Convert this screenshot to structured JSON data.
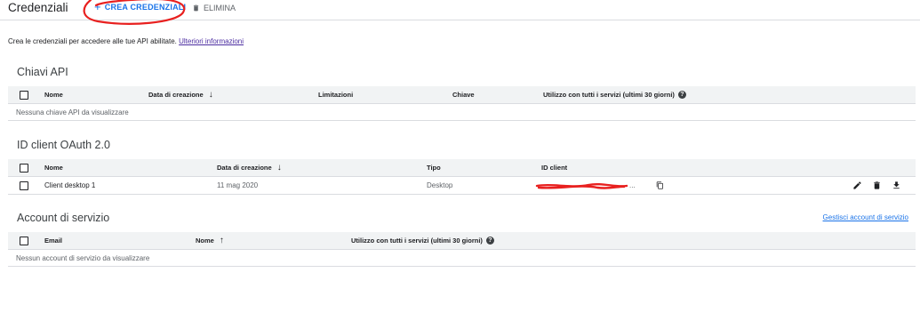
{
  "header": {
    "title": "Credenziali",
    "create_label": "CREA CREDENZIALI",
    "delete_label": "ELIMINA"
  },
  "intro": {
    "text": "Crea le credenziali per accedere alle tue API abilitate.",
    "link": "Ulteriori informazioni"
  },
  "api_keys": {
    "title": "Chiavi API",
    "columns": [
      "Nome",
      "Data di creazione",
      "Limitazioni",
      "Chiave",
      "Utilizzo con tutti i servizi (ultimi 30 giorni)"
    ],
    "empty": "Nessuna chiave API da visualizzare"
  },
  "oauth": {
    "title": "ID client OAuth 2.0",
    "columns": [
      "Nome",
      "Data di creazione",
      "Tipo",
      "ID client"
    ],
    "rows": [
      {
        "name": "Client desktop 1",
        "date": "11 mag 2020",
        "type": "Desktop",
        "client_id_suffix": "..."
      }
    ]
  },
  "service_accounts": {
    "title": "Account di servizio",
    "manage_link": "Gestisci account di servizio",
    "columns": [
      "Email",
      "Nome",
      "Utilizzo con tutti i servizi (ultimi 30 giorni)"
    ],
    "empty": "Nessun account di servizio da visualizzare"
  },
  "colors": {
    "accent": "#1a73e8",
    "annotation_red": "#e8201f",
    "header_bg": "#f1f3f4"
  }
}
